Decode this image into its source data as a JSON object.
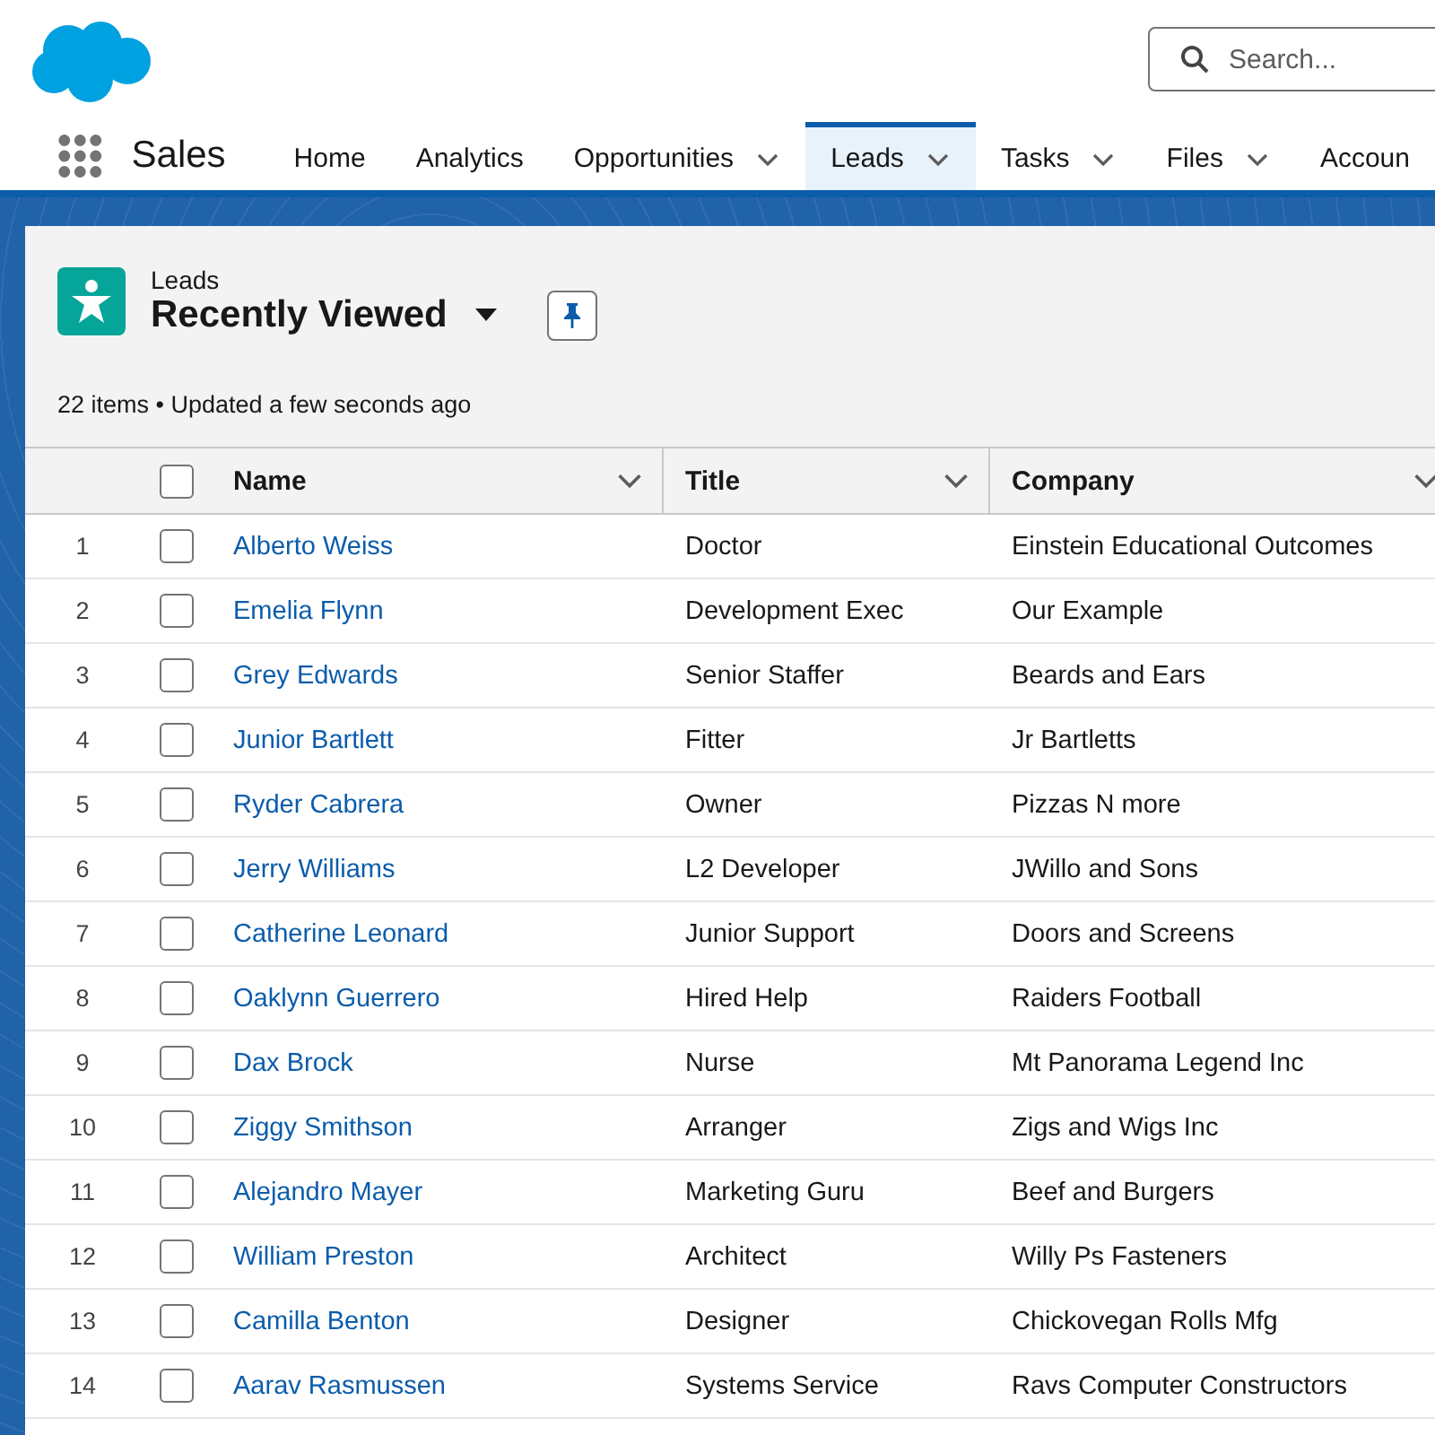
{
  "app": {
    "name": "Sales"
  },
  "search": {
    "placeholder": "Search..."
  },
  "nav": [
    {
      "label": "Home",
      "has_menu": false,
      "selected": false
    },
    {
      "label": "Analytics",
      "has_menu": false,
      "selected": false
    },
    {
      "label": "Opportunities",
      "has_menu": true,
      "selected": false
    },
    {
      "label": "Leads",
      "has_menu": true,
      "selected": true
    },
    {
      "label": "Tasks",
      "has_menu": true,
      "selected": false
    },
    {
      "label": "Files",
      "has_menu": true,
      "selected": false
    },
    {
      "label": "Accoun",
      "has_menu": false,
      "selected": false
    }
  ],
  "list_view": {
    "object": "Leads",
    "title": "Recently Viewed",
    "status": "22 items • Updated a few seconds ago"
  },
  "table": {
    "select_all_checked": false,
    "columns": [
      "Name",
      "Title",
      "Company"
    ],
    "rows": [
      {
        "number": "1",
        "name": "Alberto Weiss",
        "title": "Doctor",
        "company": "Einstein Educational Outcomes",
        "checked": false
      },
      {
        "number": "2",
        "name": "Emelia Flynn",
        "title": "Development Exec",
        "company": "Our Example",
        "checked": false
      },
      {
        "number": "3",
        "name": "Grey Edwards",
        "title": "Senior Staffer",
        "company": "Beards and Ears",
        "checked": false
      },
      {
        "number": "4",
        "name": "Junior Bartlett",
        "title": "Fitter",
        "company": "Jr Bartletts",
        "checked": false
      },
      {
        "number": "5",
        "name": "Ryder Cabrera",
        "title": "Owner",
        "company": "Pizzas N more",
        "checked": false
      },
      {
        "number": "6",
        "name": "Jerry Williams",
        "title": "L2 Developer",
        "company": "JWillo and Sons",
        "checked": false
      },
      {
        "number": "7",
        "name": "Catherine Leonard",
        "title": "Junior Support",
        "company": "Doors and Screens",
        "checked": false
      },
      {
        "number": "8",
        "name": "Oaklynn Guerrero",
        "title": "Hired Help",
        "company": "Raiders Football",
        "checked": false
      },
      {
        "number": "9",
        "name": "Dax Brock",
        "title": "Nurse",
        "company": "Mt Panorama Legend Inc",
        "checked": false
      },
      {
        "number": "10",
        "name": "Ziggy Smithson",
        "title": "Arranger",
        "company": "Zigs and Wigs Inc",
        "checked": false
      },
      {
        "number": "11",
        "name": "Alejandro Mayer",
        "title": "Marketing Guru",
        "company": "Beef and Burgers",
        "checked": false
      },
      {
        "number": "12",
        "name": "William Preston",
        "title": "Architect",
        "company": "Willy Ps Fasteners",
        "checked": false
      },
      {
        "number": "13",
        "name": "Camilla Benton",
        "title": "Designer",
        "company": "Chickovegan Rolls Mfg",
        "checked": false
      },
      {
        "number": "14",
        "name": "Aarav Rasmussen",
        "title": "Systems Service",
        "company": "Ravs Computer Constructors",
        "checked": false
      }
    ]
  }
}
